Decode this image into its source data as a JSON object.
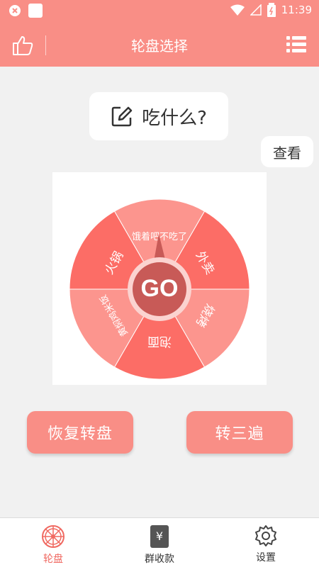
{
  "status_bar": {
    "time": "11:39"
  },
  "app_bar": {
    "title": "轮盘选择"
  },
  "question": {
    "text": "吃什么?"
  },
  "view_button": {
    "label": "查看"
  },
  "wheel": {
    "center_label": "GO",
    "segments": [
      {
        "label": "外卖",
        "color": "#fc6d66"
      },
      {
        "label": "烧烤",
        "color": "#fc958e"
      },
      {
        "label": "泡面",
        "color": "#fc6d66"
      },
      {
        "label": "黄焖鸡米饭",
        "color": "#fc958e"
      },
      {
        "label": "火锅",
        "color": "#fc6d66"
      },
      {
        "label": "饿着吧不吃了",
        "color": "#fc958e"
      }
    ]
  },
  "buttons": {
    "restore": "恢复转盘",
    "spin_three": "转三遍"
  },
  "bottom_nav": {
    "items": [
      {
        "label": "轮盘",
        "icon": "wheel-icon"
      },
      {
        "label": "群收款",
        "icon": "yuan-icon"
      },
      {
        "label": "设置",
        "icon": "gear-icon"
      }
    ]
  },
  "colors": {
    "accent": "#f98e86",
    "active": "#f06a62",
    "center": "#c85a57"
  }
}
